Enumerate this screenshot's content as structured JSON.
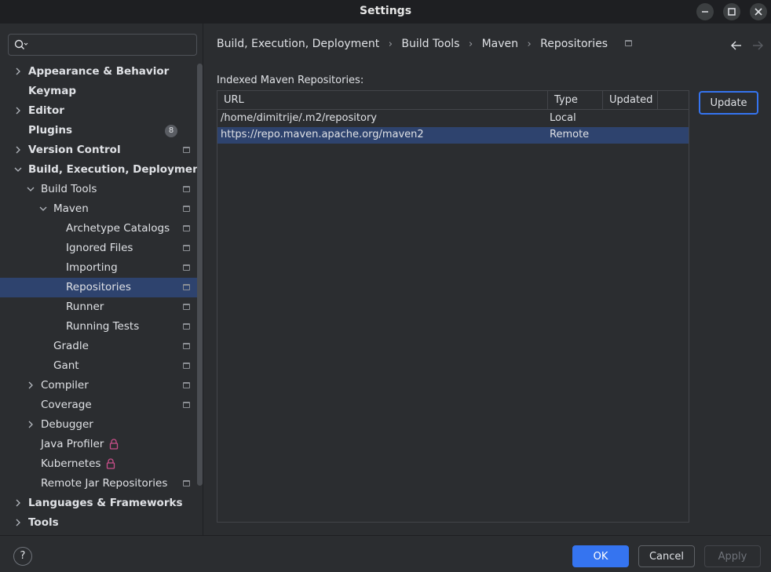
{
  "window": {
    "title": "Settings"
  },
  "search": {
    "placeholder": ""
  },
  "sidebar": {
    "items": [
      {
        "label": "Appearance & Behavior",
        "level": 0,
        "expandable": true,
        "expanded": false,
        "bold": true
      },
      {
        "label": "Keymap",
        "level": 0,
        "expandable": false,
        "bold": true
      },
      {
        "label": "Editor",
        "level": 0,
        "expandable": true,
        "expanded": false,
        "bold": true
      },
      {
        "label": "Plugins",
        "level": 0,
        "expandable": false,
        "bold": true,
        "badge": "8"
      },
      {
        "label": "Version Control",
        "level": 0,
        "expandable": true,
        "expanded": false,
        "bold": true,
        "project": true
      },
      {
        "label": "Build, Execution, Deployment",
        "level": 0,
        "expandable": true,
        "expanded": true,
        "bold": true
      },
      {
        "label": "Build Tools",
        "level": 1,
        "expandable": true,
        "expanded": true,
        "project": true
      },
      {
        "label": "Maven",
        "level": 2,
        "expandable": true,
        "expanded": true,
        "project": true
      },
      {
        "label": "Archetype Catalogs",
        "level": 3,
        "project": true
      },
      {
        "label": "Ignored Files",
        "level": 3,
        "project": true
      },
      {
        "label": "Importing",
        "level": 3,
        "project": true
      },
      {
        "label": "Repositories",
        "level": 3,
        "project": true,
        "selected": true
      },
      {
        "label": "Runner",
        "level": 3,
        "project": true
      },
      {
        "label": "Running Tests",
        "level": 3,
        "project": true
      },
      {
        "label": "Gradle",
        "level": 2,
        "project": true
      },
      {
        "label": "Gant",
        "level": 2,
        "project": true
      },
      {
        "label": "Compiler",
        "level": 1,
        "expandable": true,
        "expanded": false,
        "project": true
      },
      {
        "label": "Coverage",
        "level": 1,
        "project": true
      },
      {
        "label": "Debugger",
        "level": 1,
        "expandable": true,
        "expanded": false
      },
      {
        "label": "Java Profiler",
        "level": 1,
        "locked": true
      },
      {
        "label": "Kubernetes",
        "level": 1,
        "locked": true
      },
      {
        "label": "Remote Jar Repositories",
        "level": 1,
        "project": true
      },
      {
        "label": "Languages & Frameworks",
        "level": 0,
        "expandable": true,
        "expanded": false,
        "bold": true
      },
      {
        "label": "Tools",
        "level": 0,
        "expandable": true,
        "expanded": false,
        "bold": true
      }
    ]
  },
  "breadcrumb": [
    "Build, Execution, Deployment",
    "Build Tools",
    "Maven",
    "Repositories"
  ],
  "breadcrumb_sep": "›",
  "content": {
    "section_label": "Indexed Maven Repositories:",
    "table": {
      "columns": [
        "URL",
        "Type",
        "Updated"
      ],
      "rows": [
        {
          "url": "/home/dimitrije/.m2/repository",
          "type": "Local",
          "updated": ""
        },
        {
          "url": "https://repo.maven.apache.org/maven2",
          "type": "Remote",
          "updated": "",
          "selected": true
        }
      ]
    },
    "update_label": "Update"
  },
  "footer": {
    "help": "?",
    "ok": "OK",
    "cancel": "Cancel",
    "apply": "Apply"
  },
  "colors": {
    "accent": "#3574f0",
    "selection": "#2e436e",
    "background": "#2b2d30",
    "lock": "#c94f8a"
  }
}
